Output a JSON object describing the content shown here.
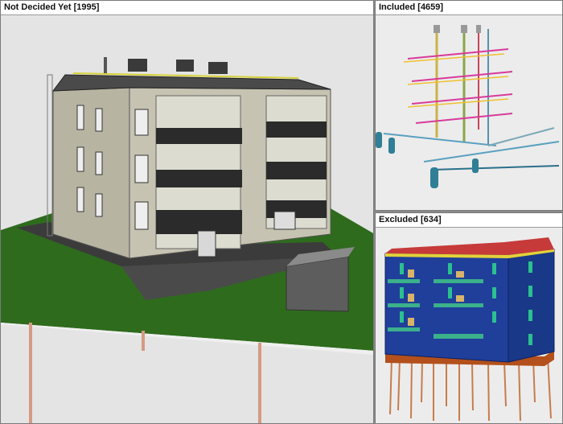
{
  "views": {
    "not_decided": {
      "title": "Not Decided Yet [1995]"
    },
    "included": {
      "title": "Included [4659]"
    },
    "excluded": {
      "title": "Excluded [634]"
    }
  }
}
